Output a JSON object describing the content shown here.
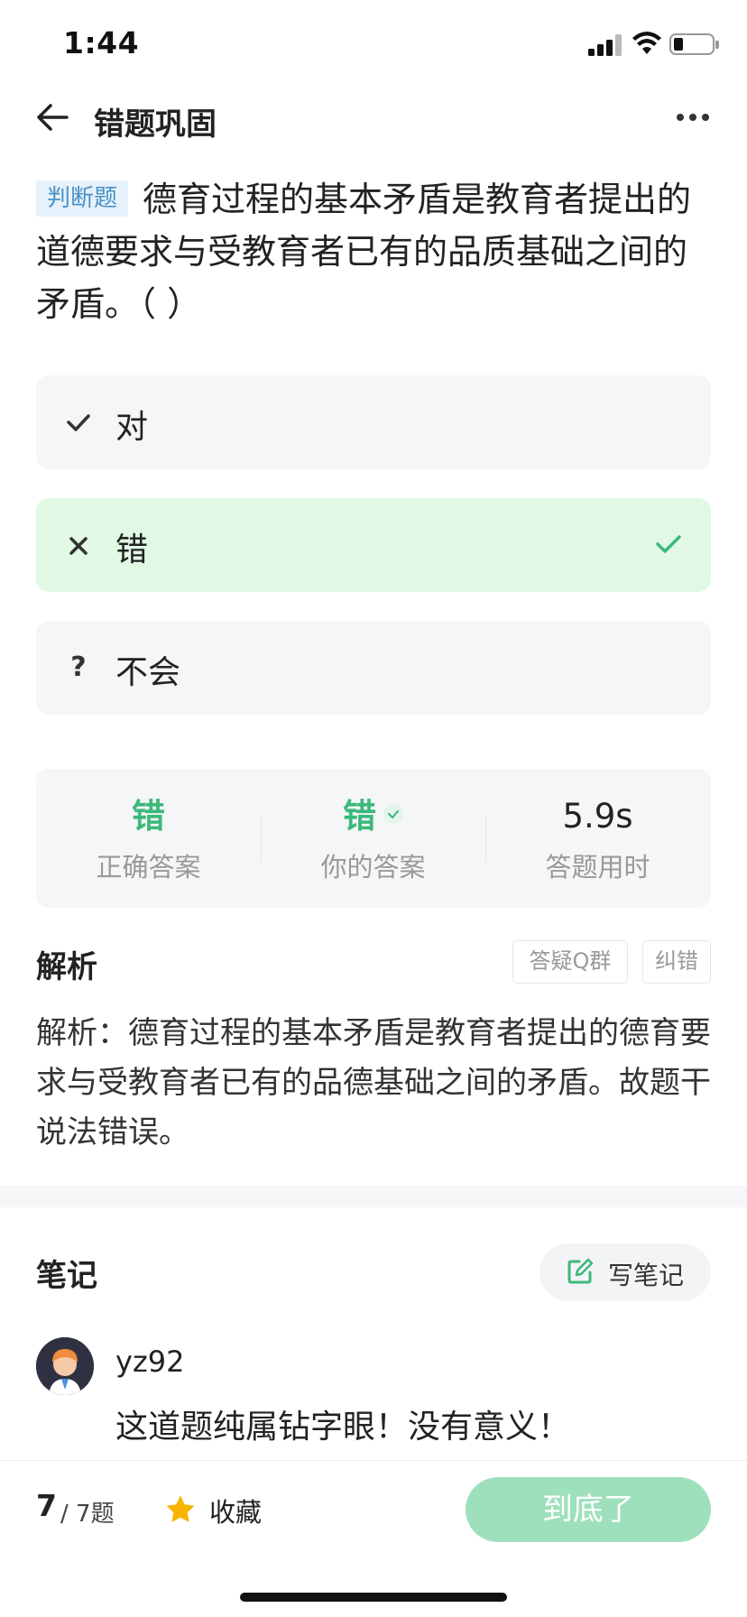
{
  "status": {
    "time": "1:44"
  },
  "nav": {
    "title": "错题巩固"
  },
  "question": {
    "type_tag": "判断题",
    "text": "德育过程的基本矛盾是教育者提出的道德要求与受教育者已有的品质基础之间的矛盾。（ ）"
  },
  "options": [
    {
      "icon": "✓",
      "label": "对"
    },
    {
      "icon": "✕",
      "label": "错",
      "state": "correct"
    },
    {
      "icon": "?",
      "label": "不会"
    }
  ],
  "summary": {
    "correct_answer": "错",
    "correct_answer_label": "正确答案",
    "your_answer": "错",
    "your_answer_label": "你的答案",
    "time": "5.9s",
    "time_label": "答题用时"
  },
  "analysis": {
    "title": "解析",
    "qa_group_btn": "答疑Q群",
    "report_error_btn": "纠错",
    "text": "解析：德育过程的基本矛盾是教育者提出的德育要求与受教育者已有的品德基础之间的矛盾。故题干说法错误。"
  },
  "notes": {
    "title": "笔记",
    "write_btn": "写笔记",
    "items": [
      {
        "user": "yz92",
        "text": "这道题纯属钻字眼！没有意义！"
      }
    ]
  },
  "bottom": {
    "current": "7",
    "total_text": "/ 7题",
    "favorite": "收藏",
    "end_btn": "到底了"
  },
  "colors": {
    "accent_green": "#3cb97a",
    "correct_bg": "#e1f9e4",
    "end_btn_bg": "#9ee0bc",
    "tag_bg": "#e6f2fb",
    "tag_text": "#4a90c4",
    "star": "#f7b500"
  }
}
